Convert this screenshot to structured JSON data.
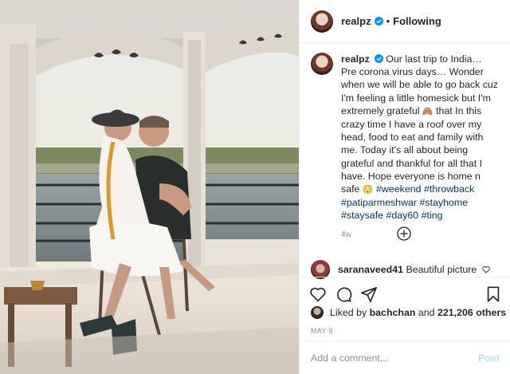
{
  "post": {
    "username": "realpz",
    "separator": "•",
    "follow_status": "Following"
  },
  "caption": {
    "username": "realpz",
    "text_part1": "Our last trip to India… Pre corona virus days… Wonder when we will be able to go back cuz I'm feeling a little homesick but I'm extremely grateful ",
    "emoji1": "🙈",
    "text_part2": " that In this crazy time I have a roof over my head, food to eat and family with me. Today it's all about being grateful and thankful for all that I have. Hope everyone is home n safe ",
    "emoji2": "😳",
    "hashtags": [
      "#weekend",
      "#throwback",
      "#patiparmeshwar",
      "#stayhome",
      "#staysafe",
      "#day60",
      "#ting"
    ],
    "age": "4w"
  },
  "comment": {
    "username": "saranaveed41",
    "text": "Beautiful picture"
  },
  "likes": {
    "prefix": "Liked by ",
    "user": "bachchan",
    "middle": " and ",
    "count": "221,206 others"
  },
  "date": "MAY 9",
  "add_comment": {
    "placeholder": "Add a comment...",
    "post_label": "Post"
  },
  "colors": {
    "accent_blue": "#0095f6",
    "hashtag": "#00376b",
    "muted": "#8e8e8e",
    "post_disabled": "#b2dffc"
  },
  "icons": [
    "heart-icon",
    "comment-icon",
    "share-icon",
    "bookmark-icon",
    "add-circle-icon",
    "verified-badge-icon"
  ]
}
